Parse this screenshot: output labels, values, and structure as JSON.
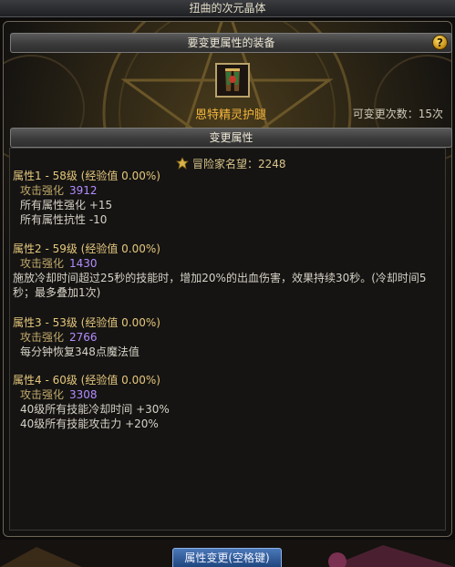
{
  "window": {
    "title": "扭曲的次元晶体"
  },
  "equip_section": {
    "header": "要变更属性的装备",
    "help": "?"
  },
  "equipment": {
    "name": "恩特精灵护腿",
    "change_count": "可变更次数：15次",
    "icon": "leg-armor-icon"
  },
  "attr_section": {
    "header": "变更属性"
  },
  "reputation": {
    "label": "冒险家名望：2248",
    "icon": "adventurer-fame-icon"
  },
  "attributes": [
    {
      "title": "属性1 - 58级 (经验值 0.00%)",
      "enhance_label": "攻击强化",
      "enhance_value": "3912",
      "lines": [
        "所有属性强化 +15",
        "所有属性抗性 -10"
      ]
    },
    {
      "title": "属性2 - 59级 (经验值 0.00%)",
      "enhance_label": "攻击强化",
      "enhance_value": "1430",
      "desc": "施放冷却时间超过25秒的技能时，增加20%的出血伤害，效果持续30秒。(冷却时间5秒；最多叠加1次)"
    },
    {
      "title": "属性3 - 53级 (经验值 0.00%)",
      "enhance_label": "攻击强化",
      "enhance_value": "2766",
      "lines": [
        "每分钟恢复348点魔法值"
      ]
    },
    {
      "title": "属性4 - 60级 (经验值 0.00%)",
      "enhance_label": "攻击强化",
      "enhance_value": "3308",
      "lines": [
        "40级所有技能冷却时间 +30%",
        "40级所有技能攻击力 +20%"
      ]
    }
  ],
  "footer": {
    "button": "属性变更(空格键)"
  },
  "colors": {
    "accent_gold": "#f4b53c",
    "value_purple": "#b38cff",
    "button_blue": "#2f5a98"
  }
}
